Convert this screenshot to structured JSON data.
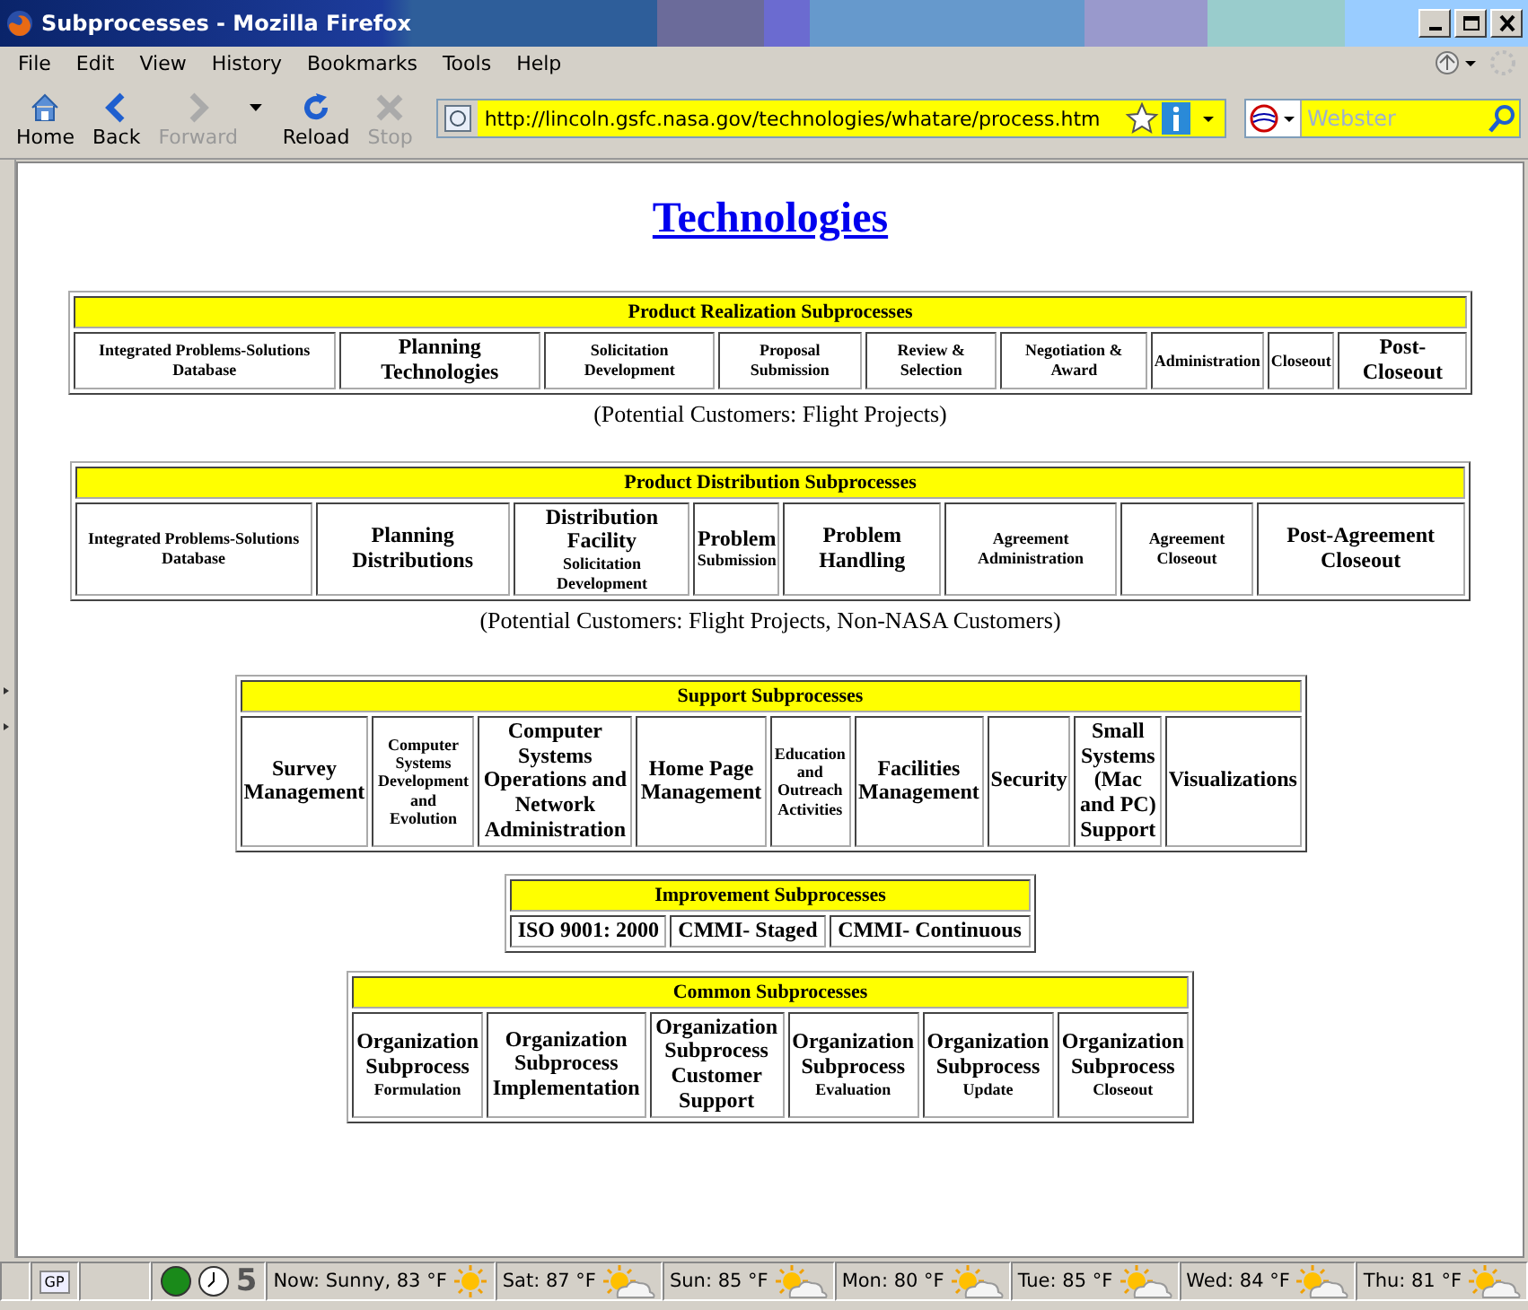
{
  "window": {
    "title": "Subprocesses - Mozilla Firefox"
  },
  "menu": [
    "File",
    "Edit",
    "View",
    "History",
    "Bookmarks",
    "Tools",
    "Help"
  ],
  "toolbar": [
    {
      "label": "Home",
      "kind": "home",
      "disabled": false
    },
    {
      "label": "Back",
      "kind": "back",
      "disabled": false
    },
    {
      "label": "Forward",
      "kind": "forward",
      "disabled": true
    },
    {
      "label": "Reload",
      "kind": "reload",
      "disabled": false
    },
    {
      "label": "Stop",
      "kind": "stop",
      "disabled": true
    }
  ],
  "address": {
    "value": "http://lincoln.gsfc.nasa.gov/technologies/whatare/process.htm"
  },
  "search": {
    "placeholder": "Webster"
  },
  "page": {
    "heading": "Technologies",
    "sections": [
      {
        "title": "Product Realization Subprocesses",
        "note": "(Potential Customers: Flight Projects)",
        "cells": [
          {
            "text": "Integrated Problems-Solutions Database",
            "kind": "small"
          },
          {
            "text": "Planning Technologies",
            "kind": "large"
          },
          {
            "text": "Solicitation Development",
            "kind": "small"
          },
          {
            "text": "Proposal Submission",
            "kind": "small"
          },
          {
            "text": "Review & Selection",
            "kind": "small"
          },
          {
            "text": "Negotiation & Award",
            "kind": "small"
          },
          {
            "text": "Administration",
            "kind": "small"
          },
          {
            "text": "Closeout",
            "kind": "small"
          },
          {
            "text": "Post-Closeout",
            "kind": "large"
          }
        ]
      },
      {
        "title": "Product Distribution Subprocesses",
        "note": "(Potential Customers: Flight Projects, Non-NASA Customers)",
        "cells": [
          {
            "text": "Integrated Problems-Solutions Database",
            "kind": "small"
          },
          {
            "text": "Planning Distributions",
            "kind": "large"
          },
          {
            "text": "Distribution Facility",
            "subtext": "Solicitation Development",
            "kind": "large"
          },
          {
            "text": "Problem",
            "subtext": "Submission",
            "kind": "large"
          },
          {
            "text": "Problem Handling",
            "kind": "large"
          },
          {
            "text": "Agreement Administration",
            "kind": "small"
          },
          {
            "text": "Agreement Closeout",
            "kind": "small"
          },
          {
            "text": "Post-Agreement Closeout",
            "kind": "large"
          }
        ]
      },
      {
        "title": "Support Subprocesses",
        "cells": [
          {
            "text": "Survey Management",
            "kind": "large"
          },
          {
            "text": "Computer Systems Development and Evolution",
            "kind": "small"
          },
          {
            "text": "Computer Systems Operations and Network Administration",
            "kind": "large"
          },
          {
            "text": "Home Page Management",
            "kind": "large"
          },
          {
            "text": "Education and Outreach Activities",
            "kind": "small"
          },
          {
            "text": "Facilities Management",
            "kind": "large"
          },
          {
            "text": "Security",
            "kind": "large"
          },
          {
            "text": "Small Systems (Mac and PC) Support",
            "kind": "large"
          },
          {
            "text": "Visualizations",
            "kind": "large"
          }
        ]
      },
      {
        "title": "Improvement Subprocesses",
        "cells": [
          {
            "text": "ISO 9001: 2000",
            "kind": "large"
          },
          {
            "text": "CMMI- Staged",
            "kind": "large"
          },
          {
            "text": "CMMI- Continuous",
            "kind": "large"
          }
        ]
      },
      {
        "title": "Common Subprocesses",
        "cells": [
          {
            "text": "Organization Subprocess",
            "subtext": "Formulation",
            "kind": "large"
          },
          {
            "text": "Organization Subprocess Implementation",
            "kind": "large"
          },
          {
            "text": "Organization Subprocess Customer Support",
            "kind": "large"
          },
          {
            "text": "Organization Subprocess",
            "subtext": "Evaluation",
            "kind": "large"
          },
          {
            "text": "Organization Subprocess",
            "subtext": "Update",
            "kind": "large"
          },
          {
            "text": "Organization Subprocess",
            "subtext": "Closeout",
            "kind": "large"
          }
        ]
      }
    ]
  },
  "status_bar": {
    "gp": "GP",
    "count": "5",
    "weather": [
      {
        "text": "Now: Sunny, 83 °F",
        "kind": "sunny"
      },
      {
        "text": "Sat: 87 °F",
        "kind": "partly-cloudy"
      },
      {
        "text": "Sun: 85 °F",
        "kind": "partly-cloudy"
      },
      {
        "text": "Mon: 80 °F",
        "kind": "partly-cloudy"
      },
      {
        "text": "Tue: 85 °F",
        "kind": "partly-cloudy"
      },
      {
        "text": "Wed: 84 °F",
        "kind": "partly-cloudy"
      },
      {
        "text": "Thu: 81 °F",
        "kind": "partly-cloudy"
      }
    ]
  }
}
